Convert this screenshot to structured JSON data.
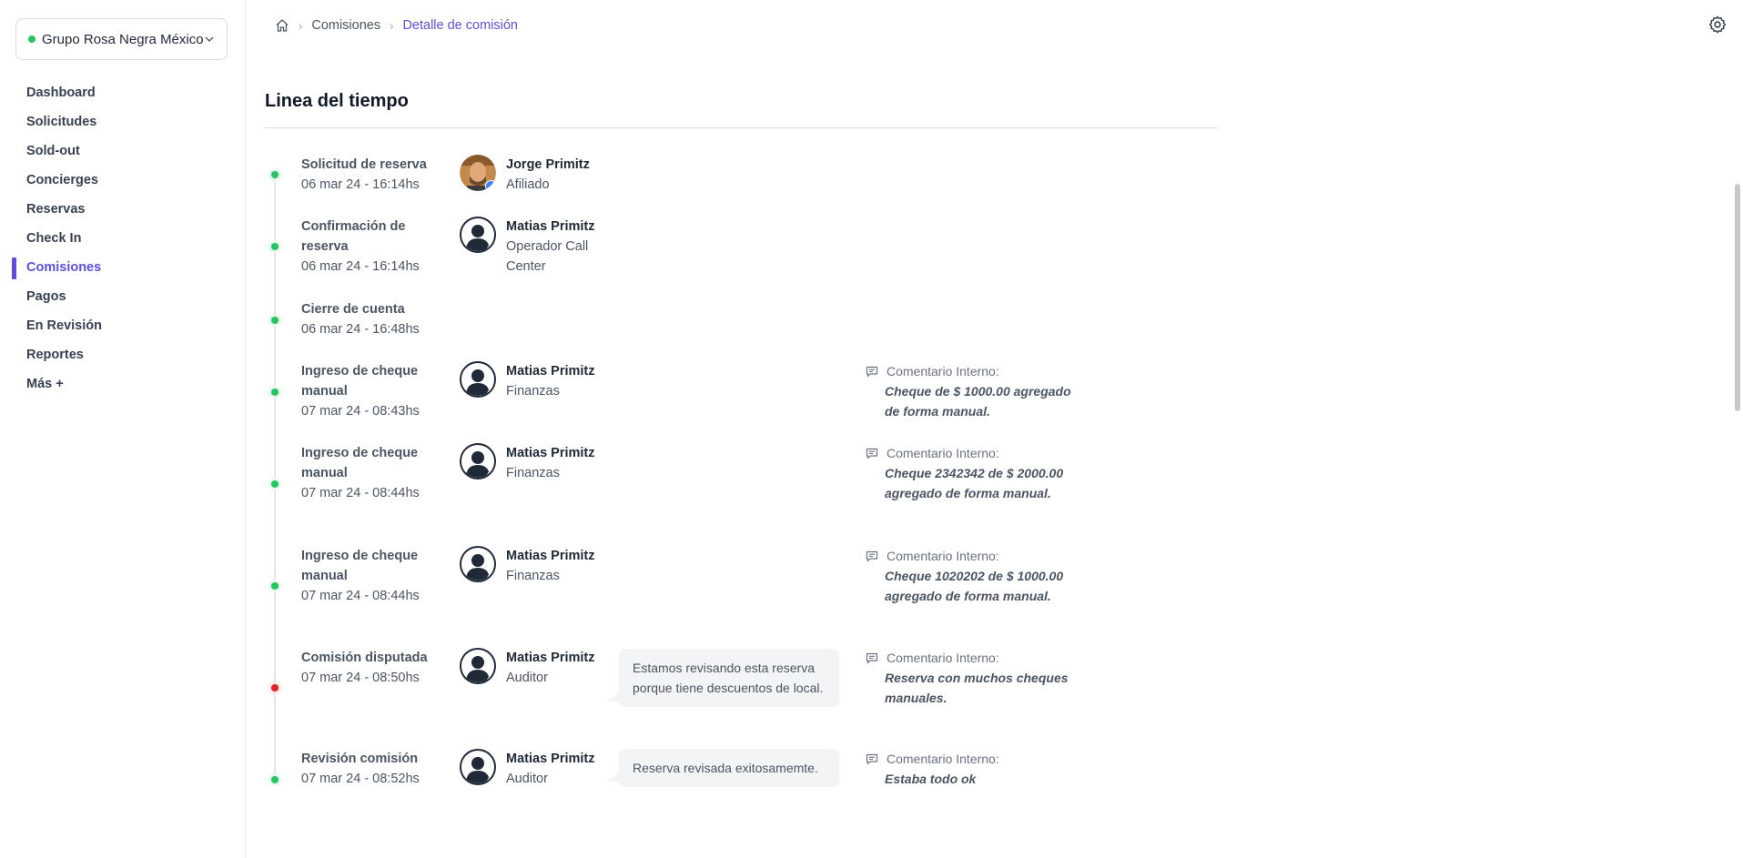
{
  "org_selector": {
    "name": "Grupo Rosa Negra México",
    "status_color": "#22c55e"
  },
  "sidebar": {
    "items": [
      {
        "label": "Dashboard",
        "active": false
      },
      {
        "label": "Solicitudes",
        "active": false
      },
      {
        "label": "Sold-out",
        "active": false
      },
      {
        "label": "Concierges",
        "active": false
      },
      {
        "label": "Reservas",
        "active": false
      },
      {
        "label": "Check In",
        "active": false
      },
      {
        "label": "Comisiones",
        "active": true
      },
      {
        "label": "Pagos",
        "active": false
      },
      {
        "label": "En Revisión",
        "active": false
      },
      {
        "label": "Reportes",
        "active": false
      },
      {
        "label": "Más +",
        "active": false
      }
    ]
  },
  "breadcrumb": {
    "home_icon": "home-icon",
    "parent": "Comisiones",
    "current": "Detalle de comisión"
  },
  "header": {
    "settings_icon": "gear-icon"
  },
  "timeline": {
    "title": "Linea del tiempo",
    "events": [
      {
        "title": "Solicitud de reserva",
        "date": "06 mar 24 - 16:14hs",
        "status": "success",
        "actor": {
          "name": "Jorge Primitz",
          "role": "Afiliado",
          "avatar": "photo"
        }
      },
      {
        "title": "Confirmación de reserva",
        "date": "06 mar 24 - 16:14hs",
        "status": "success",
        "actor": {
          "name": "Matias Primitz",
          "role": "Operador Call Center",
          "avatar": "default"
        }
      },
      {
        "title": "Cierre de cuenta",
        "date": "06 mar 24 - 16:48hs",
        "status": "success"
      },
      {
        "title": "Ingreso de cheque manual",
        "date": "07 mar 24 - 08:43hs",
        "status": "success",
        "actor": {
          "name": "Matias Primitz",
          "role": "Finanzas",
          "avatar": "default"
        },
        "internal_comment": {
          "label": "Comentario Interno:",
          "text": "Cheque de $ 1000.00 agregado de forma manual."
        }
      },
      {
        "title": "Ingreso de cheque manual",
        "date": "07 mar 24 - 08:44hs",
        "status": "success",
        "actor": {
          "name": "Matias Primitz",
          "role": "Finanzas",
          "avatar": "default"
        },
        "internal_comment": {
          "label": "Comentario Interno:",
          "text": "Cheque 2342342 de $ 2000.00 agregado de forma manual."
        }
      },
      {
        "title": "Ingreso de cheque manual",
        "date": "07 mar 24 - 08:44hs",
        "status": "success",
        "actor": {
          "name": "Matias Primitz",
          "role": "Finanzas",
          "avatar": "default"
        },
        "internal_comment": {
          "label": "Comentario Interno:",
          "text": "Cheque 1020202 de $ 1000.00 agregado de forma manual."
        }
      },
      {
        "title": "Comisión disputada",
        "date": "07 mar 24 - 08:50hs",
        "status": "error",
        "actor": {
          "name": "Matias Primitz",
          "role": "Auditor",
          "avatar": "default"
        },
        "message": "Estamos revisando esta reserva porque tiene descuentos de local.",
        "internal_comment": {
          "label": "Comentario Interno:",
          "text": "Reserva con muchos cheques manuales."
        }
      },
      {
        "title": "Revisión comisión",
        "date": "07 mar 24 - 08:52hs",
        "status": "success",
        "actor": {
          "name": "Matias Primitz",
          "role": "Auditor",
          "avatar": "default"
        },
        "message": "Reserva revisada exitosamemte.",
        "internal_comment": {
          "label": "Comentario Interno:",
          "text": "Estaba todo ok"
        }
      }
    ]
  },
  "colors": {
    "accent": "#5b4fe0",
    "success": "#22c55e",
    "error": "#dc2626",
    "verified": "#3b82f6"
  }
}
